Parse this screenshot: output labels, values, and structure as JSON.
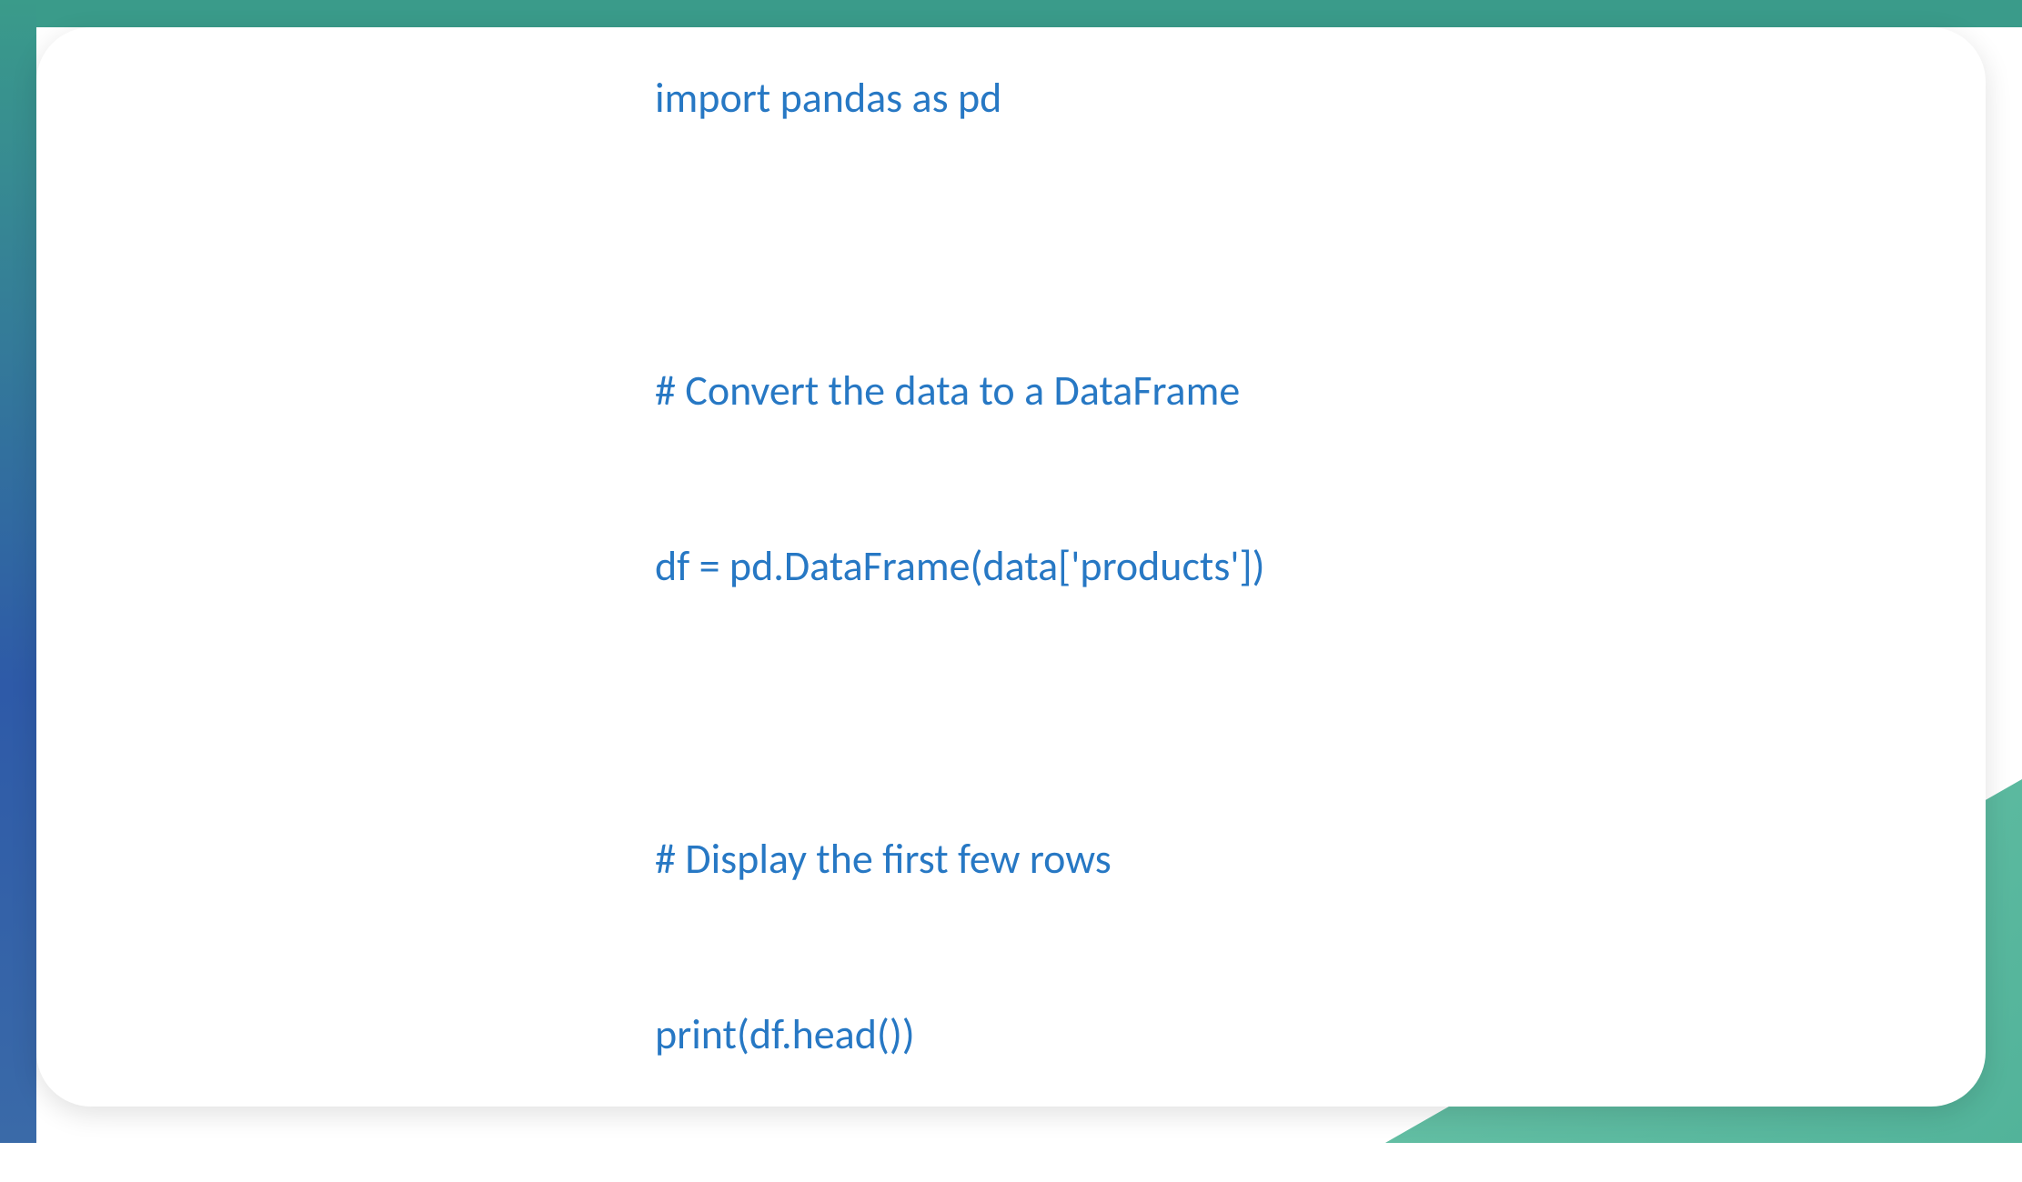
{
  "code": {
    "line1": "import pandas as pd",
    "line2": "",
    "line3": "# Convert the data to a DataFrame",
    "line4": "df = pd.DataFrame(data['products'])",
    "line5": "",
    "line6": "# Display the first few rows",
    "line7": "print(df.head())"
  },
  "colors": {
    "code_text": "#2778c4",
    "teal": "#3a9b8a",
    "blue": "#2e5aa8",
    "light_teal": "#6bc4a8"
  }
}
